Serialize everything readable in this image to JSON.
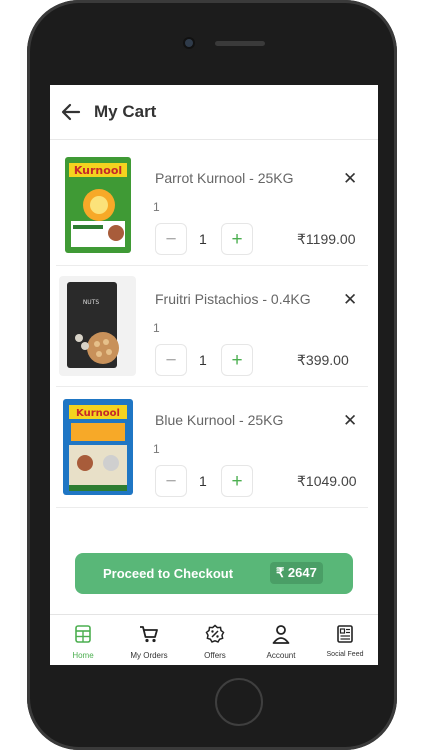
{
  "header": {
    "title": "My Cart"
  },
  "cart": {
    "items": [
      {
        "name": "Parrot Kurnool - 25KG",
        "unit_qty": "1",
        "quantity": "1",
        "price": "₹1199.00"
      },
      {
        "name": "Fruitri Pistachios - 0.4KG",
        "unit_qty": "1",
        "quantity": "1",
        "price": "₹399.00"
      },
      {
        "name": "Blue Kurnool - 25KG",
        "unit_qty": "1",
        "quantity": "1",
        "price": "₹1049.00"
      }
    ],
    "minus_symbol": "−",
    "plus_symbol": "+",
    "remove_symbol": "✕",
    "product_image_text": {
      "item0": "Kurnool",
      "item1": "NUTS",
      "item2": "Kurnool"
    }
  },
  "checkout": {
    "label": "Proceed to Checkout",
    "total": "₹ 2647"
  },
  "bottom_nav": {
    "items": [
      {
        "label": "Home",
        "icon": "home-icon",
        "active": true
      },
      {
        "label": "My Orders",
        "icon": "cart-icon",
        "active": false
      },
      {
        "label": "Offers",
        "icon": "offer-tag-icon",
        "active": false
      },
      {
        "label": "Account",
        "icon": "user-icon",
        "active": false
      },
      {
        "label": "Social Feed",
        "icon": "feed-icon",
        "active": false
      }
    ]
  },
  "colors": {
    "accent": "#59b778",
    "active_nav": "#4caf50",
    "text": "#333333"
  }
}
